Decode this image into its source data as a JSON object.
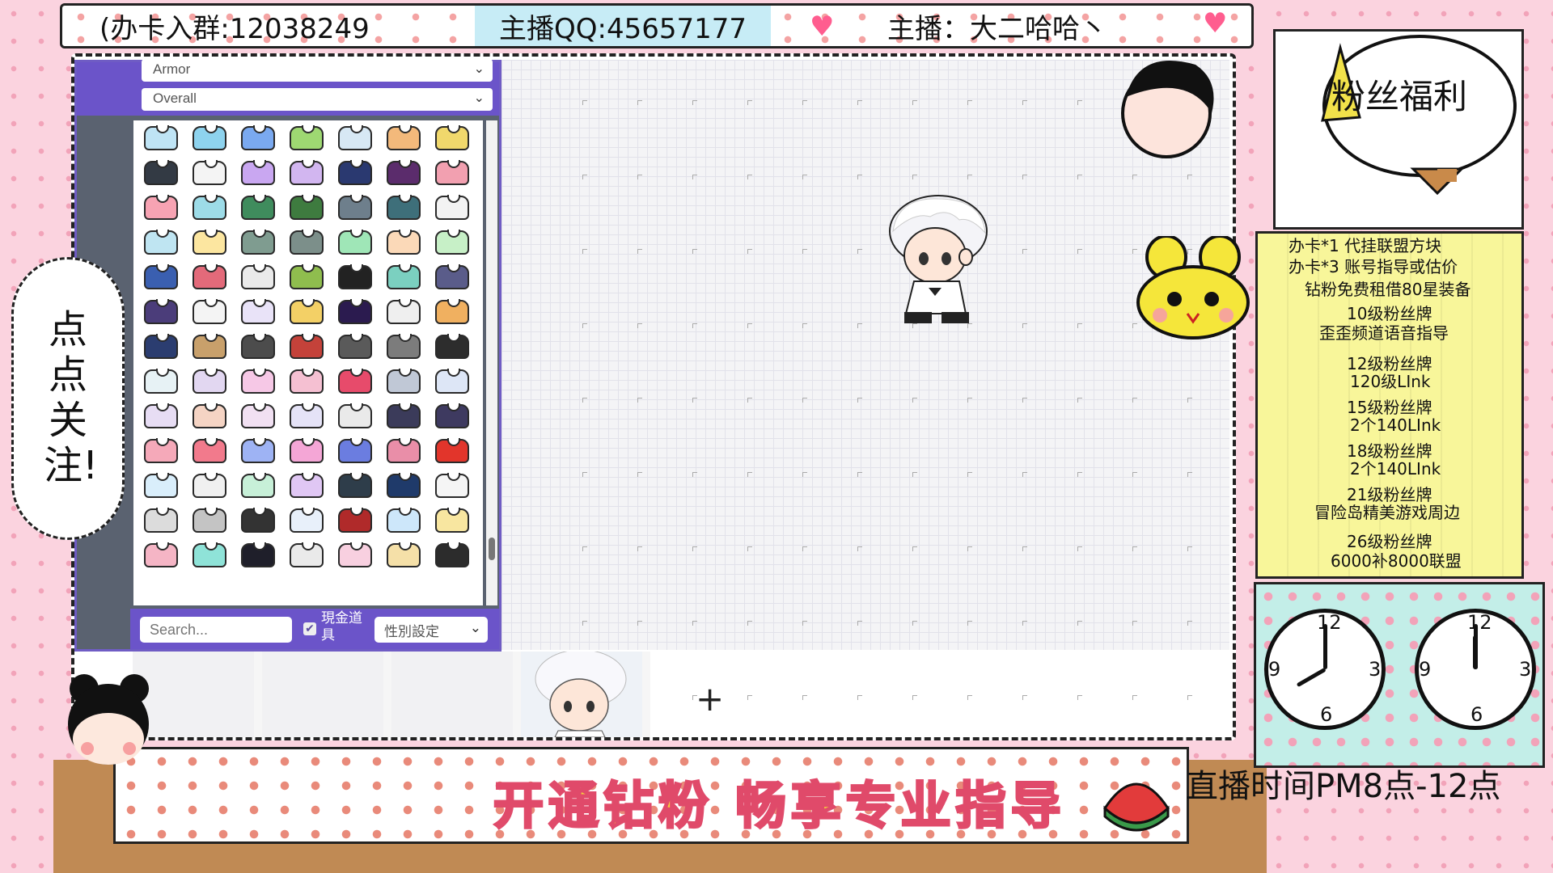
{
  "header": {
    "group_text": "(办卡入群:12038249",
    "qq_text": "主播QQ:45657177",
    "host_text": "主播：大二哈哈丶"
  },
  "editor": {
    "category_select": "Armor",
    "subcategory_select": "Overall",
    "search_placeholder": "Search...",
    "cash_item_label": "現金道具",
    "cash_item_checked": true,
    "gender_select": "性別設定"
  },
  "item_colors": [
    "#bfe4f5",
    "#8ed3ee",
    "#7aa9f0",
    "#9ed872",
    "#d7e8f4",
    "#f3b97b",
    "#f0d86c",
    "#333a44",
    "#f4f4f4",
    "#c9a7f1",
    "#d2b6f0",
    "#2a3970",
    "#5b2c6c",
    "#f2a0b0",
    "#f7a3b3",
    "#9ddce8",
    "#3f8c5d",
    "#3e7b3f",
    "#6e7f8c",
    "#3e6f7a",
    "#f3f3f3",
    "#bfe5f2",
    "#fce6a0",
    "#7f9c90",
    "#7c8f8a",
    "#9fe6b7",
    "#fbd9b8",
    "#c7f0c7",
    "#3a5fb0",
    "#e36a7a",
    "#eaeaea",
    "#8fbd4e",
    "#222222",
    "#7bd0c0",
    "#5a5c8a",
    "#4b3d7a",
    "#f4f4f4",
    "#e9e3f8",
    "#f3d066",
    "#2b1b4f",
    "#efefef",
    "#f0b060",
    "#2b3d70",
    "#c8a06b",
    "#4c4c4c",
    "#c4423a",
    "#5a5a5a",
    "#7c7c7c",
    "#2d2d2d",
    "#e7f2f5",
    "#e2d7f1",
    "#f6c8e6",
    "#f5c0d2",
    "#e74b6b",
    "#c0c8d6",
    "#dde6f6",
    "#e7ddf4",
    "#f5d4c4",
    "#f1e0f2",
    "#e5e3f7",
    "#eaeaea",
    "#3b3b5a",
    "#3e3a60",
    "#f5a9b9",
    "#f27a8c",
    "#9eb3f4",
    "#f4a6d6",
    "#6b7de0",
    "#e98ea8",
    "#e2352b",
    "#d9eefb",
    "#f0f0f0",
    "#c7f0d8",
    "#e0c7f4",
    "#2e3d4a",
    "#1f3a6a",
    "#f5f5f5",
    "#dcdcdc",
    "#c4c4c4",
    "#333333",
    "#e8f0fa",
    "#b02a2a",
    "#cde7fa",
    "#f8e6a0",
    "#f5b5c5",
    "#8fe3d8",
    "#1f1f2a",
    "#eaeaea",
    "#f8d0e0",
    "#f5e0a8",
    "#2c2c2c"
  ],
  "canvas_tools": {
    "add_symbol": "+"
  },
  "welfare": {
    "title": "粉丝福利",
    "items": [
      "办卡*1 代挂联盟方块",
      "办卡*3 账号指导或估价",
      "钻粉免费租借80星装备",
      "10级粉丝牌",
      "歪歪频道语音指导",
      "12级粉丝牌",
      "120级LInk",
      "15级粉丝牌",
      "2个140LInk",
      "18级粉丝牌",
      "2个140LInk",
      "21级粉丝牌",
      "冒险岛精美游戏周边",
      "26级粉丝牌",
      "6000补8000联盟"
    ]
  },
  "clocks": {
    "numbers": [
      "12",
      "3",
      "6",
      "9"
    ]
  },
  "schedule": {
    "broadcast_time": "直播时间PM8点-12点"
  },
  "banner": {
    "text": "开通钻粉 畅享专业指导"
  },
  "follow": {
    "text": "点点关注!"
  }
}
